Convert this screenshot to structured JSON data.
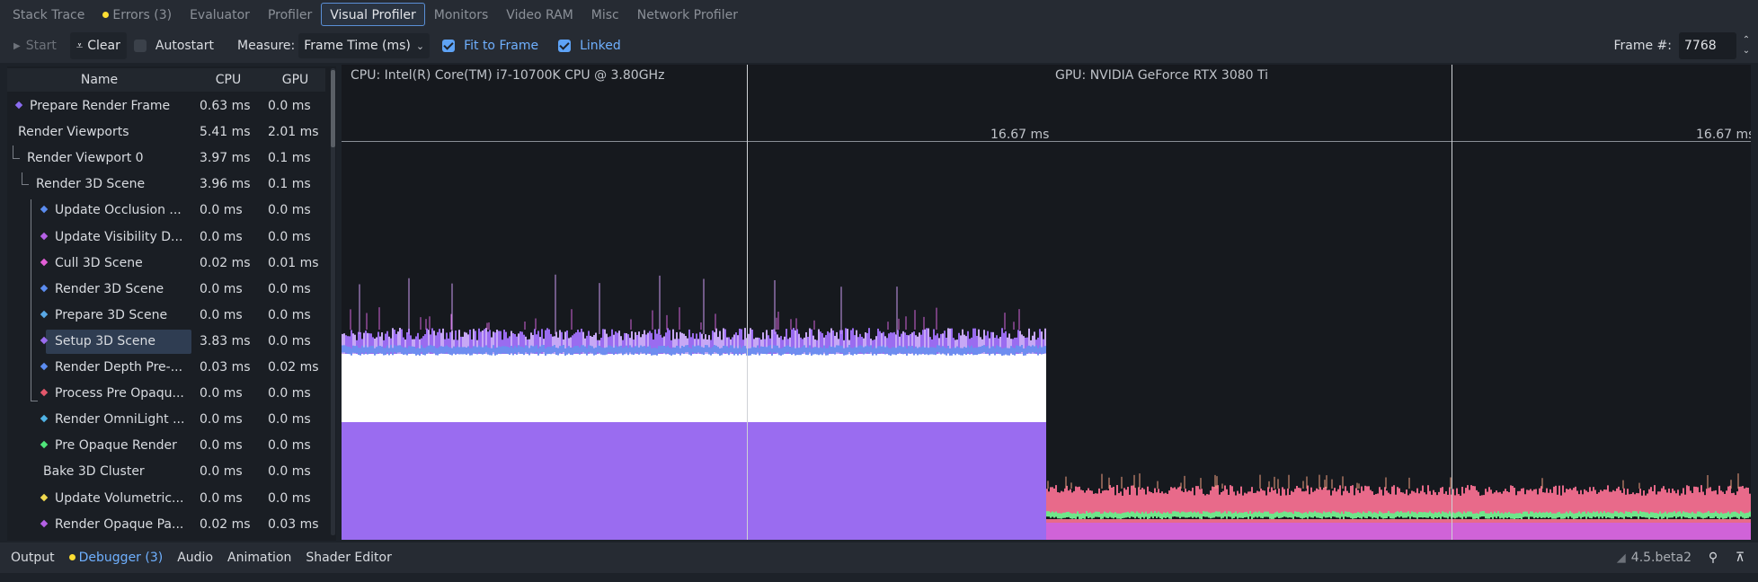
{
  "tabs": [
    {
      "label": "Stack Trace"
    },
    {
      "label": "Errors (3)",
      "dot": true
    },
    {
      "label": "Evaluator"
    },
    {
      "label": "Profiler"
    },
    {
      "label": "Visual Profiler",
      "active": true
    },
    {
      "label": "Monitors"
    },
    {
      "label": "Video RAM"
    },
    {
      "label": "Misc"
    },
    {
      "label": "Network Profiler"
    }
  ],
  "toolbar": {
    "start_label": "Start",
    "clear_label": "Clear",
    "autostart_label": "Autostart",
    "measure_label": "Measure:",
    "measure_value": "Frame Time (ms)",
    "fit_to_frame_label": "Fit to Frame",
    "linked_label": "Linked",
    "frame_label": "Frame #:",
    "frame_value": "7768"
  },
  "tree": {
    "columns": {
      "name": "Name",
      "cpu": "CPU",
      "gpu": "GPU"
    },
    "rows": [
      {
        "name": "Prepare Render Frame",
        "cpu": "0.63 ms",
        "gpu": "0.0 ms",
        "level": 0,
        "color": "#8a6cf0"
      },
      {
        "name": "Render Viewports",
        "cpu": "5.41 ms",
        "gpu": "2.01 ms",
        "level": 0
      },
      {
        "name": "Render Viewport 0",
        "cpu": "3.97 ms",
        "gpu": "0.1 ms",
        "level": 1
      },
      {
        "name": "Render 3D Scene",
        "cpu": "3.96 ms",
        "gpu": "0.1 ms",
        "level": 2
      },
      {
        "name": "Update Occlusion ...",
        "cpu": "0.0 ms",
        "gpu": "0.0 ms",
        "level": 3,
        "color": "#5b8cf0"
      },
      {
        "name": "Update Visibility D...",
        "cpu": "0.0 ms",
        "gpu": "0.0 ms",
        "level": 3,
        "color": "#b561e6"
      },
      {
        "name": "Cull 3D Scene",
        "cpu": "0.02 ms",
        "gpu": "0.01 ms",
        "level": 3,
        "color": "#e35fd6"
      },
      {
        "name": "Render 3D Scene",
        "cpu": "0.0 ms",
        "gpu": "0.0 ms",
        "level": 3,
        "color": "#5b8cf0"
      },
      {
        "name": "Prepare 3D Scene",
        "cpu": "0.0 ms",
        "gpu": "0.0 ms",
        "level": 3,
        "color": "#59a8e6"
      },
      {
        "name": "Setup 3D Scene",
        "cpu": "3.83 ms",
        "gpu": "0.0 ms",
        "level": 3,
        "color": "#9a6cf0",
        "selected": true
      },
      {
        "name": "Render Depth Pre-...",
        "cpu": "0.03 ms",
        "gpu": "0.02 ms",
        "level": 3,
        "color": "#5b8cf0"
      },
      {
        "name": "Process Pre Opaqu...",
        "cpu": "0.0 ms",
        "gpu": "0.0 ms",
        "level": 3,
        "color": "#e3576b"
      },
      {
        "name": "Render OmniLight ...",
        "cpu": "0.0 ms",
        "gpu": "0.0 ms",
        "level": 3,
        "color": "#4fb3e6"
      },
      {
        "name": "Pre Opaque Render",
        "cpu": "0.0 ms",
        "gpu": "0.0 ms",
        "level": 3,
        "color": "#4fe67a"
      },
      {
        "name": "Bake 3D Cluster",
        "cpu": "0.0 ms",
        "gpu": "0.0 ms",
        "level": 3
      },
      {
        "name": "Update Volumetric...",
        "cpu": "0.0 ms",
        "gpu": "0.0 ms",
        "level": 3,
        "color": "#f0d94f"
      },
      {
        "name": "Render Opaque Pa...",
        "cpu": "0.02 ms",
        "gpu": "0.03 ms",
        "level": 3,
        "color": "#b561e6"
      }
    ]
  },
  "graph": {
    "cpu_label": "CPU: Intel(R) Core(TM) i7-10700K CPU @ 3.80GHz",
    "gpu_label": "GPU: NVIDIA GeForce RTX 3080 Ti",
    "cpu_ms_label": "16.67 ms",
    "gpu_ms_label": "16.67 ms",
    "colors": {
      "white": "#ffffff",
      "violet": "#9a6cf0",
      "lavender": "#c7a8f5",
      "blue": "#6e8df0",
      "pink": "#e86a8a",
      "green": "#6fe68a",
      "magenta": "#d063d8"
    }
  },
  "bottom": {
    "tabs": [
      {
        "label": "Output"
      },
      {
        "label": "Debugger (3)",
        "dot": true,
        "accent": true
      },
      {
        "label": "Audio"
      },
      {
        "label": "Animation"
      },
      {
        "label": "Shader Editor"
      }
    ],
    "version": "4.5.beta2"
  }
}
